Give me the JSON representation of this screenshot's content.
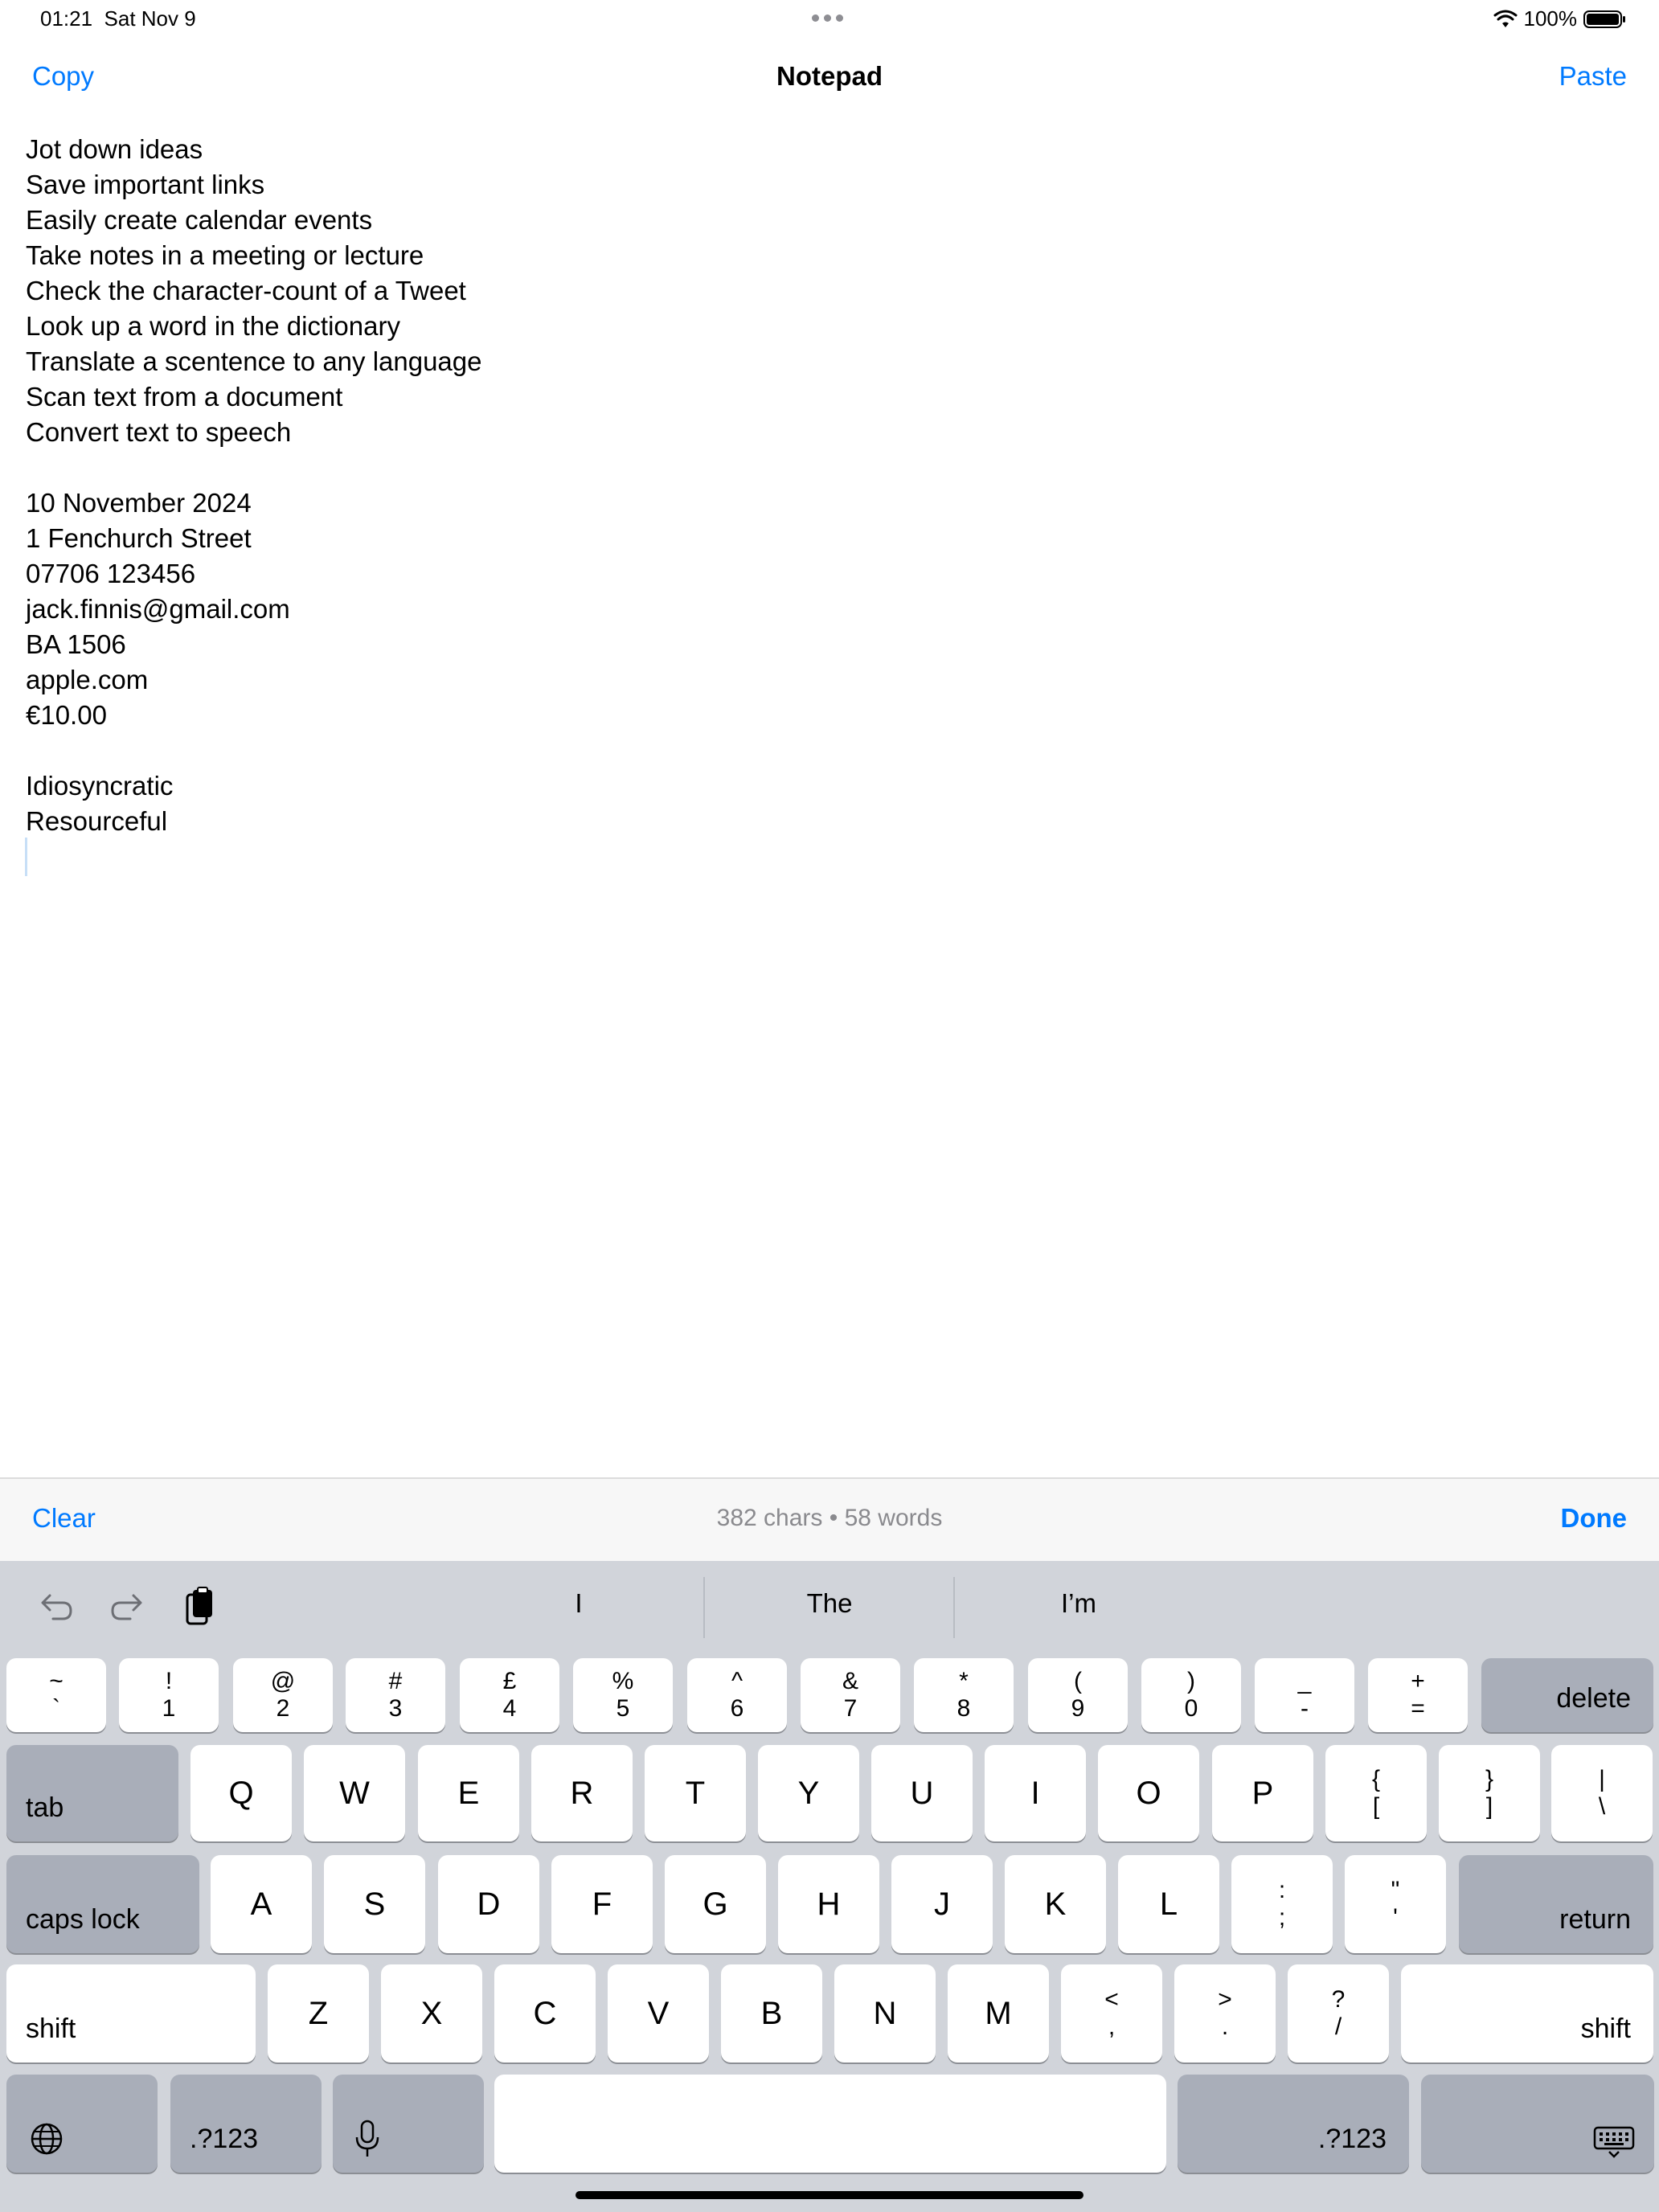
{
  "status_bar": {
    "time": "01:21",
    "date": "Sat Nov 9",
    "battery": "100%"
  },
  "nav": {
    "left_button": "Copy",
    "title": "Notepad",
    "right_button": "Paste"
  },
  "note": {
    "lines": [
      "Jot down ideas",
      "Save important links",
      "Easily create calendar events",
      "Take notes in a meeting or lecture",
      "Check the character-count of a Tweet",
      "Look up a word in the dictionary",
      "Translate a scentence to any language",
      "Scan text from a document",
      "Convert text to speech",
      "",
      "10 November 2024",
      "1 Fenchurch Street",
      "07706 123456",
      "jack.finnis@gmail.com",
      "BA 1506",
      "apple.com",
      "€10.00",
      "",
      "Idiosyncratic",
      "Resourceful"
    ]
  },
  "accessory": {
    "clear": "Clear",
    "count": "382 chars • 58 words",
    "done": "Done"
  },
  "keyboard": {
    "suggestions": [
      "I",
      "The",
      "I’m"
    ],
    "number_row": [
      {
        "top": "~",
        "bottom": "`"
      },
      {
        "top": "!",
        "bottom": "1"
      },
      {
        "top": "@",
        "bottom": "2"
      },
      {
        "top": "#",
        "bottom": "3"
      },
      {
        "top": "£",
        "bottom": "4"
      },
      {
        "top": "%",
        "bottom": "5"
      },
      {
        "top": "^",
        "bottom": "6"
      },
      {
        "top": "&",
        "bottom": "7"
      },
      {
        "top": "*",
        "bottom": "8"
      },
      {
        "top": "(",
        "bottom": "9"
      },
      {
        "top": ")",
        "bottom": "0"
      },
      {
        "top": "_",
        "bottom": "-"
      },
      {
        "top": "+",
        "bottom": "="
      }
    ],
    "delete": "delete",
    "tab": "tab",
    "row_q": [
      "Q",
      "W",
      "E",
      "R",
      "T",
      "Y",
      "U",
      "I",
      "O",
      "P"
    ],
    "row_q_symbols": [
      {
        "top": "{",
        "bottom": "["
      },
      {
        "top": "}",
        "bottom": "]"
      },
      {
        "top": "|",
        "bottom": "\\"
      }
    ],
    "caps_lock": "caps lock",
    "row_a": [
      "A",
      "S",
      "D",
      "F",
      "G",
      "H",
      "J",
      "K",
      "L"
    ],
    "row_a_symbols": [
      {
        "top": ":",
        "bottom": ";"
      },
      {
        "top": "\"",
        "bottom": "'"
      }
    ],
    "return": "return",
    "shift": "shift",
    "row_z": [
      "Z",
      "X",
      "C",
      "V",
      "B",
      "N",
      "M"
    ],
    "row_z_symbols": [
      {
        "top": "<",
        "bottom": ","
      },
      {
        "top": ">",
        "bottom": "."
      },
      {
        "top": "?",
        "bottom": "/"
      }
    ],
    "numeric_label": ".?123",
    "icons": {
      "undo": "undo-icon",
      "redo": "redo-icon",
      "paste": "clipboard-icon",
      "globe": "globe-icon",
      "mic": "microphone-icon",
      "hide": "keyboard-hide-icon"
    }
  },
  "colors": {
    "accent": "#007aff",
    "keyboard_bg": "#d1d4da",
    "key": "#ffffff",
    "key_dark": "#a9aeb9"
  }
}
